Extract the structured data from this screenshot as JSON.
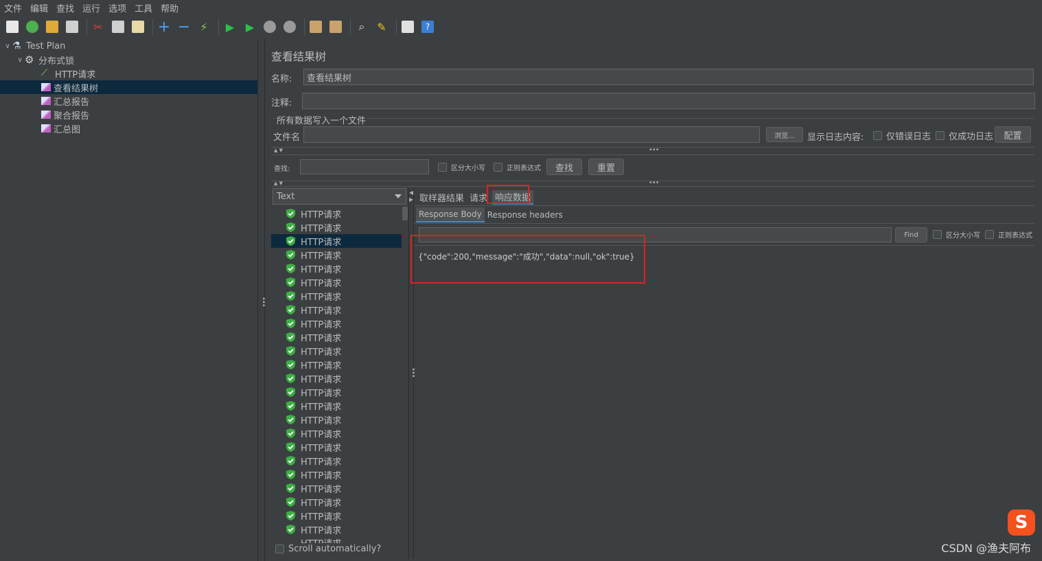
{
  "menu": [
    "文件",
    "编辑",
    "查找",
    "运行",
    "选项",
    "工具",
    "帮助"
  ],
  "toolbar_icons": [
    "new-icon",
    "templates-icon",
    "open-icon",
    "save-icon",
    "cut-icon",
    "copy-icon",
    "paste-icon",
    "expand-icon",
    "collapse-icon",
    "toggle-icon",
    "start-icon",
    "start-no-pause-icon",
    "stop-icon",
    "shutdown-icon",
    "clear-icon",
    "clear-all-icon",
    "search-icon",
    "reset-search-icon",
    "function-helper-icon",
    "help-icon"
  ],
  "tree": {
    "root": "Test Plan",
    "group": "分布式锁",
    "items": [
      "HTTP请求",
      "查看结果树",
      "汇总报告",
      "聚合报告",
      "汇总图"
    ]
  },
  "panel": {
    "title": "查看结果树",
    "name_label": "名称:",
    "name_value": "查看结果树",
    "comment_label": "注释:",
    "file_section": "所有数据写入一个文件",
    "file_label": "文件名",
    "browse": "浏览...",
    "log_label": "显示日志内容:",
    "errors_only": "仅错误日志",
    "success_only": "仅成功日志",
    "configure": "配置"
  },
  "search": {
    "label": "查找:",
    "case_sensitive": "区分大小写",
    "regex": "正则表达式",
    "find": "查找",
    "reset": "重置"
  },
  "renderer": "Text",
  "results": [
    "HTTP请求",
    "HTTP请求",
    "HTTP请求",
    "HTTP请求",
    "HTTP请求",
    "HTTP请求",
    "HTTP请求",
    "HTTP请求",
    "HTTP请求",
    "HTTP请求",
    "HTTP请求",
    "HTTP请求",
    "HTTP请求",
    "HTTP请求",
    "HTTP请求",
    "HTTP请求",
    "HTTP请求",
    "HTTP请求",
    "HTTP请求",
    "HTTP请求",
    "HTTP请求",
    "HTTP请求",
    "HTTP请求",
    "HTTP请求"
  ],
  "results_partial": "HTTP请求",
  "selected_result_index": 2,
  "scroll_auto": "Scroll automatically?",
  "tabs": [
    "取样器结果",
    "请求",
    "响应数据"
  ],
  "subtabs": [
    "Response Body",
    "Response headers"
  ],
  "find": {
    "button": "Find",
    "case_sensitive": "区分大小写",
    "regex": "正则表达式"
  },
  "response_text": "{\"code\":200,\"message\":\"成功\",\"data\":null,\"ok\":true}",
  "watermark": "CSDN @渔夫阿布",
  "colors": {
    "background": "#3c3f41",
    "selection": "#0d293e",
    "highlight_box": "#e02020",
    "success_shield": "#3cb043"
  }
}
